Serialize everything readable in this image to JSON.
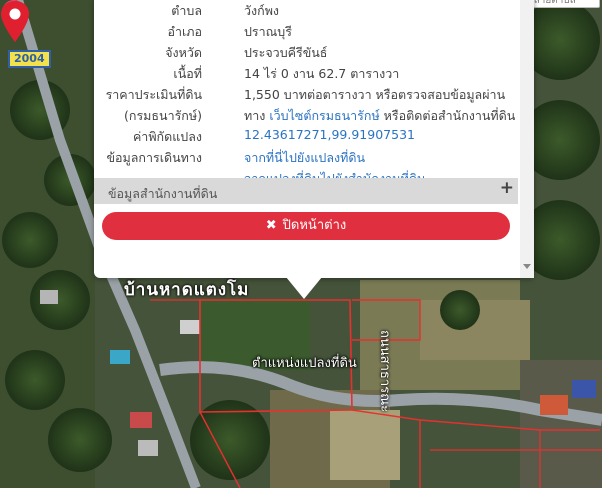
{
  "map": {
    "road_label": "2004",
    "village_label": "บ้านหาดแตงโม",
    "parcel_label": "ตำแหน่งแปลงที่ดิน",
    "road_name": "ถนนสาธารณะ",
    "topright_text": "หลายตำบล"
  },
  "popup": {
    "rows": [
      {
        "key": "ตำบล",
        "value": "วังก์พง"
      },
      {
        "key": "อำเภอ",
        "value": "ปราณบุรี"
      },
      {
        "key": "จังหวัด",
        "value": "ประจวบคีรีขันธ์"
      },
      {
        "key": "เนื้อที่",
        "value": "14 ไร่ 0 งาน 62.7 ตารางวา"
      },
      {
        "key": "ราคาประเมินที่ดิน",
        "value": "1,550 บาทต่อตารางวา หรือตรวจสอบข้อมูลผ่าน"
      },
      {
        "key": "(กรมธนารักษ์)",
        "value_prefix": "ทาง ",
        "value_link": "เว็บไซต์กรมธนารักษ์",
        "value_suffix": " หรือติดต่อสำนักงานที่ดิน"
      },
      {
        "key": "ค่าพิกัดแปลง",
        "value_link": "12.43617271,99.91907531"
      },
      {
        "key": "ข้อมูลการเดินทาง",
        "value_link": "จากที่นี่ไปยังแปลงที่ดิน"
      },
      {
        "key": "",
        "value_link": "จากแปลงที่ดินไปยังสำนักงานที่ดิน"
      }
    ],
    "office_section": "ข้อมูลสำนักงานที่ดิน",
    "office_toggle": "+",
    "close_icon": "✖",
    "close_label": "ปิดหน้าต่าง"
  }
}
